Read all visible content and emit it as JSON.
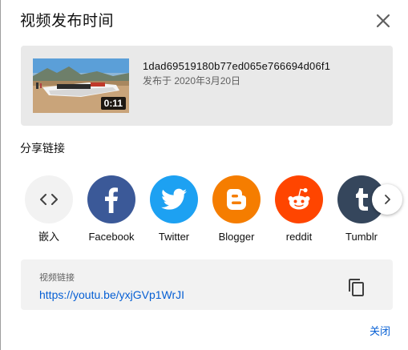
{
  "dialog": {
    "title": "视频发布时间",
    "close_icon": "close-icon"
  },
  "video": {
    "id": "1dad69519180b77ed065e766694d06f1",
    "published": "发布于 2020年3月20日",
    "duration": "0:11"
  },
  "share": {
    "heading": "分享链接",
    "items": [
      {
        "label": "嵌入",
        "icon": "embed-icon",
        "color": "#f2f2f2"
      },
      {
        "label": "Facebook",
        "icon": "facebook-icon",
        "color": "#3b5998"
      },
      {
        "label": "Twitter",
        "icon": "twitter-icon",
        "color": "#1da1f2"
      },
      {
        "label": "Blogger",
        "icon": "blogger-icon",
        "color": "#f57d00"
      },
      {
        "label": "reddit",
        "icon": "reddit-icon",
        "color": "#ff4500"
      },
      {
        "label": "Tumblr",
        "icon": "tumblr-icon",
        "color": "#35465c"
      }
    ],
    "next_icon": "chevron-right-icon"
  },
  "link": {
    "label": "视频链接",
    "url": "https://youtu.be/yxjGVp1WrJI",
    "copy_icon": "copy-icon"
  },
  "footer": {
    "close_label": "关闭"
  },
  "colors": {
    "link_blue": "#065fd4",
    "card_bg": "#e9e9e9",
    "link_box_bg": "#f2f2f2"
  }
}
